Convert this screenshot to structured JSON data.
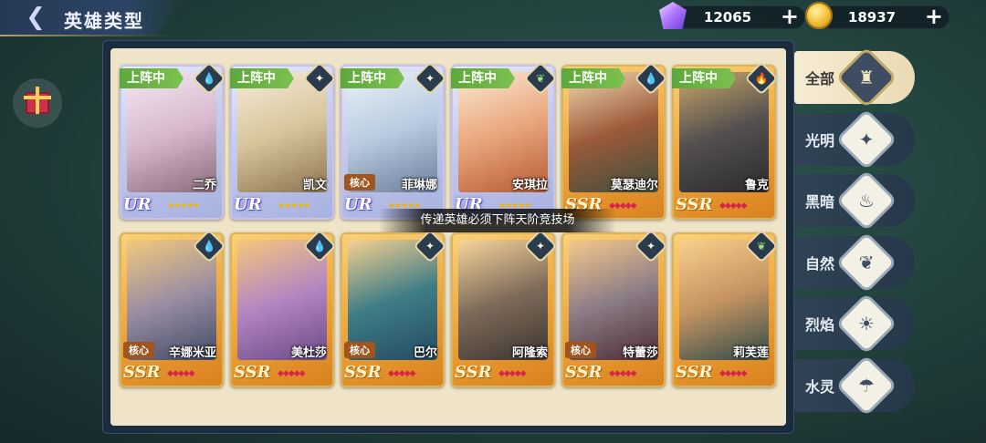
{
  "header": {
    "title": "英雄类型"
  },
  "currency": {
    "gems": "12065",
    "coins": "18937"
  },
  "toast": "传递英雄必须下阵天阶竞技场",
  "tabs": [
    {
      "label": "全部",
      "icon": "crown-tower-icon",
      "active": true
    },
    {
      "label": "光明",
      "icon": "light-star-icon"
    },
    {
      "label": "黑暗",
      "icon": "dark-flame-icon"
    },
    {
      "label": "自然",
      "icon": "nature-leaf-icon"
    },
    {
      "label": "烈焰",
      "icon": "fire-icon"
    },
    {
      "label": "水灵",
      "icon": "water-drop-icon"
    }
  ],
  "heroes": [
    {
      "name": "二乔",
      "rarity": "UR",
      "deployed_label": "上阵中",
      "element": "water",
      "core": ""
    },
    {
      "name": "凯文",
      "rarity": "UR",
      "deployed_label": "上阵中",
      "element": "light",
      "core": ""
    },
    {
      "name": "菲琳娜",
      "rarity": "UR",
      "deployed_label": "上阵中",
      "element": "light",
      "core": "核心"
    },
    {
      "name": "安琪拉",
      "rarity": "UR",
      "deployed_label": "上阵中",
      "element": "nature",
      "core": ""
    },
    {
      "name": "莫瑟迪尔",
      "rarity": "SSR",
      "deployed_label": "上阵中",
      "element": "water",
      "core": ""
    },
    {
      "name": "鲁克",
      "rarity": "SSR",
      "deployed_label": "上阵中",
      "element": "fire",
      "core": ""
    },
    {
      "name": "辛娜米亚",
      "rarity": "SSR",
      "deployed_label": "",
      "element": "water",
      "core": "核心"
    },
    {
      "name": "美杜莎",
      "rarity": "SSR",
      "deployed_label": "",
      "element": "water",
      "core": ""
    },
    {
      "name": "巴尔",
      "rarity": "SSR",
      "deployed_label": "",
      "element": "light",
      "core": "核心"
    },
    {
      "name": "阿隆索",
      "rarity": "SSR",
      "deployed_label": "",
      "element": "light",
      "core": ""
    },
    {
      "name": "特蕾莎",
      "rarity": "SSR",
      "deployed_label": "",
      "element": "light",
      "core": "核心"
    },
    {
      "name": "莉芙莲",
      "rarity": "SSR",
      "deployed_label": "",
      "element": "nature",
      "core": ""
    }
  ]
}
